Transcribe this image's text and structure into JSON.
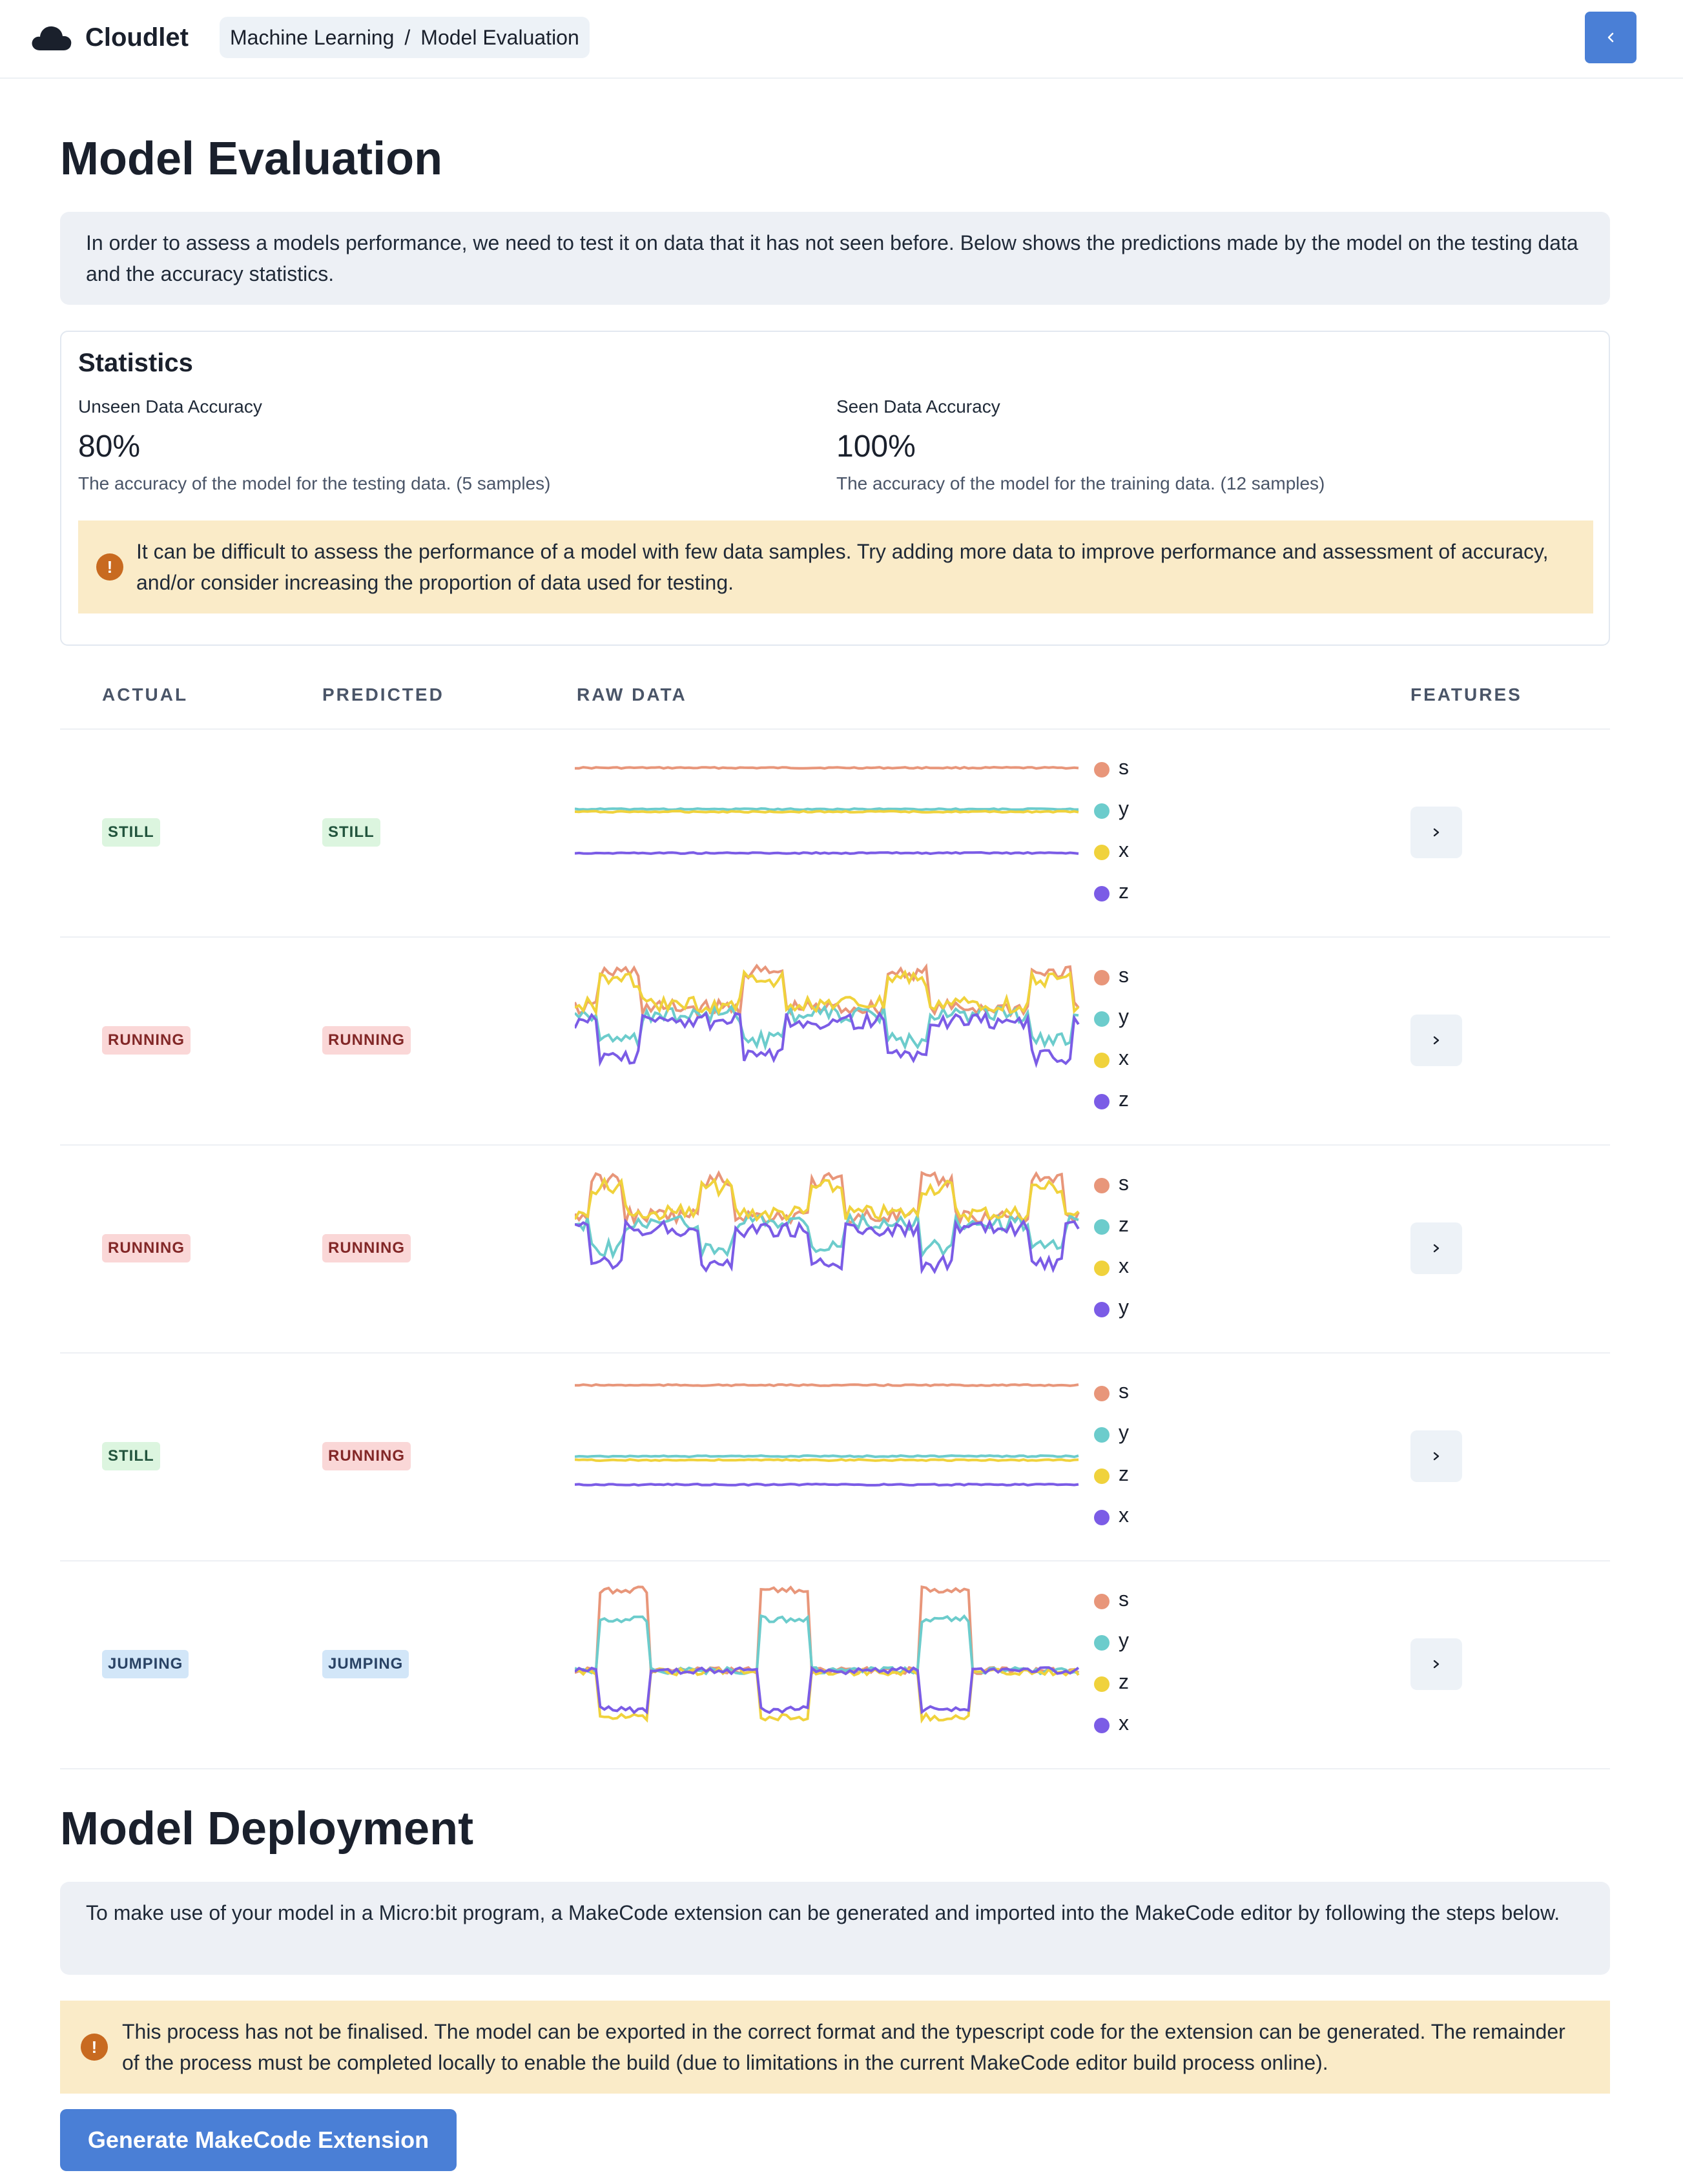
{
  "header": {
    "app_name": "Cloudlet",
    "breadcrumb": [
      "Machine Learning",
      "Model Evaluation"
    ],
    "separator": "/",
    "collapse_icon": "chevron-left-icon"
  },
  "evaluation": {
    "title": "Model Evaluation",
    "intro": "In order to assess a models performance, we need to test it on data that it has not seen before. Below shows the predictions made by the model on the testing data and the accuracy statistics."
  },
  "statistics": {
    "title": "Statistics",
    "unseen": {
      "label": "Unseen Data Accuracy",
      "value": "80%",
      "help": "The accuracy of the model for the testing data. (5 samples)"
    },
    "seen": {
      "label": "Seen Data Accuracy",
      "value": "100%",
      "help": "The accuracy of the model for the training data. (12 samples)"
    },
    "warning": "It can be difficult to assess the performance of a model with few data samples. Try adding more data to improve performance and assessment of accuracy, and/or consider increasing the proportion of data used for testing."
  },
  "table": {
    "headers": {
      "actual": "ACTUAL",
      "predicted": "PREDICTED",
      "raw": "RAW DATA",
      "features": "FEATURES"
    },
    "series_colors": [
      "#e8967a",
      "#6ccccc",
      "#f0d23c",
      "#7b5ce6"
    ],
    "rows": [
      {
        "actual": "STILL",
        "predicted": "STILL",
        "legend": [
          "s",
          "y",
          "x",
          "z"
        ],
        "shape": "flat"
      },
      {
        "actual": "RUNNING",
        "predicted": "RUNNING",
        "legend": [
          "s",
          "y",
          "x",
          "z"
        ],
        "shape": "running"
      },
      {
        "actual": "RUNNING",
        "predicted": "RUNNING",
        "legend": [
          "s",
          "z",
          "x",
          "y"
        ],
        "shape": "running2"
      },
      {
        "actual": "STILL",
        "predicted": "RUNNING",
        "legend": [
          "s",
          "y",
          "z",
          "x"
        ],
        "shape": "flat2"
      },
      {
        "actual": "JUMPING",
        "predicted": "JUMPING",
        "legend": [
          "s",
          "y",
          "z",
          "x"
        ],
        "shape": "jumping"
      }
    ]
  },
  "deployment": {
    "title": "Model Deployment",
    "intro": "To make use of your model in a Micro:bit program, a MakeCode extension can be generated and imported into the MakeCode editor by following the steps below.",
    "warning": "This process has not be finalised. The model can be exported in the correct format and the typescript code for the extension can be generated. The remainder of the process must be completed locally to enable the build (due to limitations in the current MakeCode editor build process online).",
    "button": "Generate MakeCode Extension"
  }
}
